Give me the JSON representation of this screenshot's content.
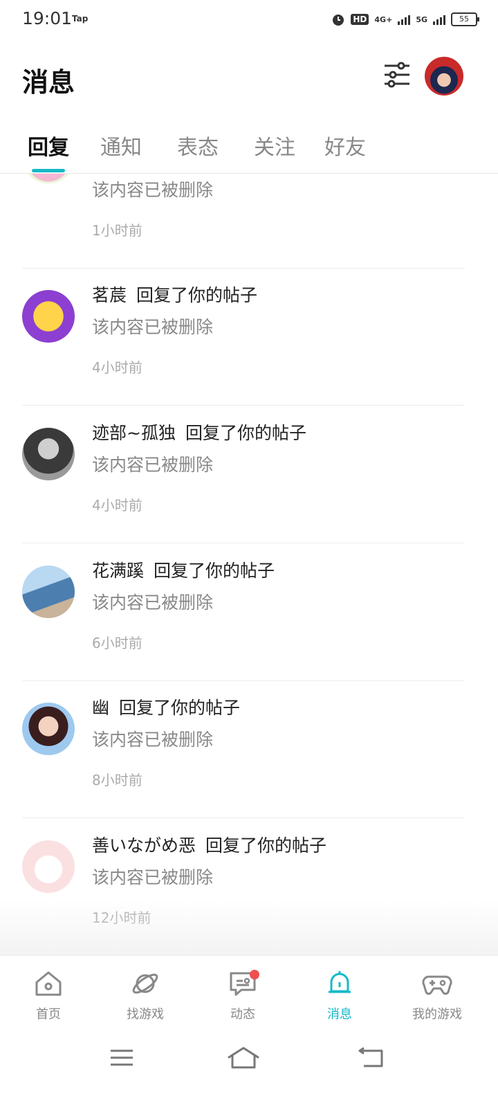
{
  "status_bar": {
    "time": "19:01",
    "app_tag": "Tap",
    "hd": "HD",
    "net1": "4G+",
    "net2": "5G",
    "battery": "55"
  },
  "header": {
    "title": "消息"
  },
  "tabs": [
    {
      "label": "回复",
      "active": true
    },
    {
      "label": "通知",
      "active": false
    },
    {
      "label": "表态",
      "active": false
    },
    {
      "label": "关注",
      "active": false
    },
    {
      "label": "好友",
      "active": false
    }
  ],
  "messages": [
    {
      "user": "",
      "action": "",
      "content": "该内容已被删除",
      "time": "1小时前"
    },
    {
      "user": "茗莀",
      "action": "回复了你的帖子",
      "content": "该内容已被删除",
      "time": "4小时前"
    },
    {
      "user": "迹部~孤独",
      "action": "回复了你的帖子",
      "content": "该内容已被删除",
      "time": "4小时前"
    },
    {
      "user": "花满蹊",
      "action": "回复了你的帖子",
      "content": "该内容已被删除",
      "time": "6小时前"
    },
    {
      "user": "幽",
      "action": "回复了你的帖子",
      "content": "该内容已被删除",
      "time": "8小时前"
    },
    {
      "user": "善いながめ恶",
      "action": "回复了你的帖子",
      "content": "该内容已被删除",
      "time": "12小时前"
    }
  ],
  "bottom_nav": [
    {
      "label": "首页",
      "icon": "home-icon"
    },
    {
      "label": "找游戏",
      "icon": "planet-icon"
    },
    {
      "label": "动态",
      "icon": "chat-icon",
      "badge": true
    },
    {
      "label": "消息",
      "icon": "bell-icon",
      "active": true
    },
    {
      "label": "我的游戏",
      "icon": "gamepad-icon"
    }
  ],
  "colors": {
    "accent": "#14b9c8",
    "badge": "#f05050"
  }
}
